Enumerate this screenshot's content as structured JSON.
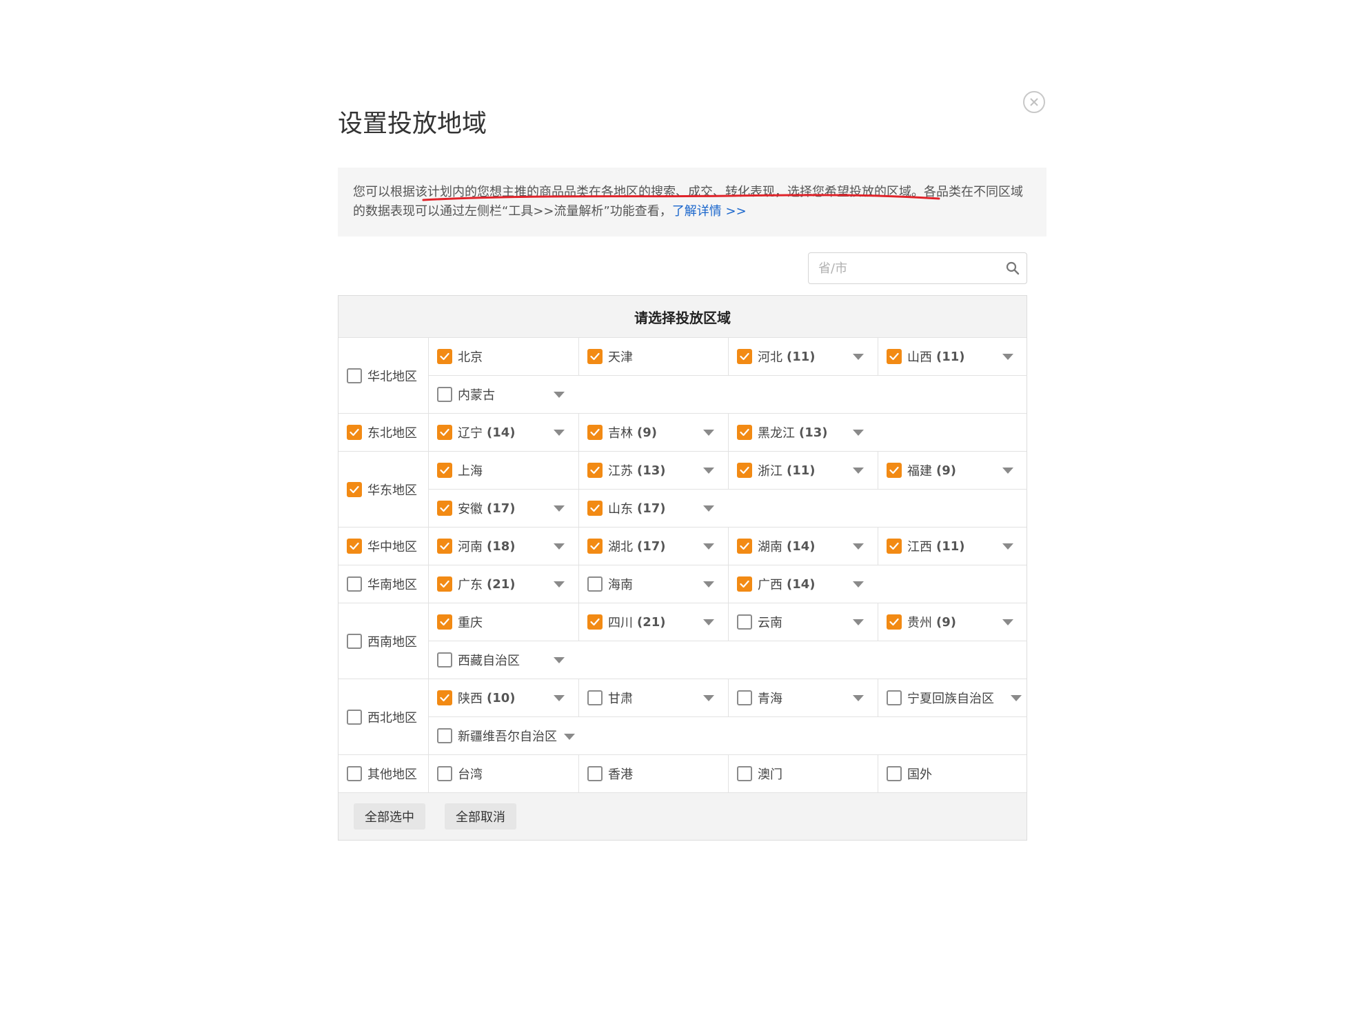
{
  "dialog": {
    "title": "设置投放地域",
    "notice_text": "您可以根据该计划内的您想主推的商品品类在各地区的搜索、成交、转化表现，选择您希望投放的区域。各品类在不同区域的数据表现可以通过左侧栏“工具>>流量解析”功能查看，",
    "notice_link": "了解详情 >>",
    "search_placeholder": "省/市",
    "panel_header": "请选择投放区域",
    "select_all": "全部选中",
    "deselect_all": "全部取消",
    "accent_color": "#f28a14",
    "link_color": "#1a66cc"
  },
  "regions": [
    {
      "label": "华北地区",
      "checked": false,
      "rows": [
        [
          {
            "name": "北京",
            "count": "",
            "checked": true,
            "dropdown": false
          },
          {
            "name": "天津",
            "count": "",
            "checked": true,
            "dropdown": false
          },
          {
            "name": "河北",
            "count": "(11)",
            "checked": true,
            "dropdown": true
          },
          {
            "name": "山西",
            "count": "(11)",
            "checked": true,
            "dropdown": true
          }
        ],
        [
          {
            "name": "内蒙古",
            "count": "",
            "checked": false,
            "dropdown": true
          }
        ]
      ]
    },
    {
      "label": "东北地区",
      "checked": true,
      "rows": [
        [
          {
            "name": "辽宁",
            "count": "(14)",
            "checked": true,
            "dropdown": true
          },
          {
            "name": "吉林",
            "count": "(9)",
            "checked": true,
            "dropdown": true
          },
          {
            "name": "黑龙江",
            "count": "(13)",
            "checked": true,
            "dropdown": true
          }
        ]
      ]
    },
    {
      "label": "华东地区",
      "checked": true,
      "rows": [
        [
          {
            "name": "上海",
            "count": "",
            "checked": true,
            "dropdown": false
          },
          {
            "name": "江苏",
            "count": "(13)",
            "checked": true,
            "dropdown": true
          },
          {
            "name": "浙江",
            "count": "(11)",
            "checked": true,
            "dropdown": true
          },
          {
            "name": "福建",
            "count": "(9)",
            "checked": true,
            "dropdown": true
          }
        ],
        [
          {
            "name": "安徽",
            "count": "(17)",
            "checked": true,
            "dropdown": true
          },
          {
            "name": "山东",
            "count": "(17)",
            "checked": true,
            "dropdown": true
          }
        ]
      ]
    },
    {
      "label": "华中地区",
      "checked": true,
      "rows": [
        [
          {
            "name": "河南",
            "count": "(18)",
            "checked": true,
            "dropdown": true
          },
          {
            "name": "湖北",
            "count": "(17)",
            "checked": true,
            "dropdown": true
          },
          {
            "name": "湖南",
            "count": "(14)",
            "checked": true,
            "dropdown": true
          },
          {
            "name": "江西",
            "count": "(11)",
            "checked": true,
            "dropdown": true
          }
        ]
      ]
    },
    {
      "label": "华南地区",
      "checked": false,
      "rows": [
        [
          {
            "name": "广东",
            "count": "(21)",
            "checked": true,
            "dropdown": true
          },
          {
            "name": "海南",
            "count": "",
            "checked": false,
            "dropdown": true
          },
          {
            "name": "广西",
            "count": "(14)",
            "checked": true,
            "dropdown": true
          }
        ]
      ]
    },
    {
      "label": "西南地区",
      "checked": false,
      "rows": [
        [
          {
            "name": "重庆",
            "count": "",
            "checked": true,
            "dropdown": false
          },
          {
            "name": "四川",
            "count": "(21)",
            "checked": true,
            "dropdown": true
          },
          {
            "name": "云南",
            "count": "",
            "checked": false,
            "dropdown": true
          },
          {
            "name": "贵州",
            "count": "(9)",
            "checked": true,
            "dropdown": true
          }
        ],
        [
          {
            "name": "西藏自治区",
            "count": "",
            "checked": false,
            "dropdown": true
          }
        ]
      ]
    },
    {
      "label": "西北地区",
      "checked": false,
      "rows": [
        [
          {
            "name": "陕西",
            "count": "(10)",
            "checked": true,
            "dropdown": true
          },
          {
            "name": "甘肃",
            "count": "",
            "checked": false,
            "dropdown": true
          },
          {
            "name": "青海",
            "count": "",
            "checked": false,
            "dropdown": true
          },
          {
            "name": "宁夏回族自治区",
            "count": "",
            "checked": false,
            "dropdown": true
          }
        ],
        [
          {
            "name": "新疆维吾尔自治区",
            "count": "",
            "checked": false,
            "dropdown": true
          }
        ]
      ]
    },
    {
      "label": "其他地区",
      "checked": false,
      "rows": [
        [
          {
            "name": "台湾",
            "count": "",
            "checked": false,
            "dropdown": false
          },
          {
            "name": "香港",
            "count": "",
            "checked": false,
            "dropdown": false
          },
          {
            "name": "澳门",
            "count": "",
            "checked": false,
            "dropdown": false
          },
          {
            "name": "国外",
            "count": "",
            "checked": false,
            "dropdown": false
          }
        ]
      ]
    }
  ]
}
